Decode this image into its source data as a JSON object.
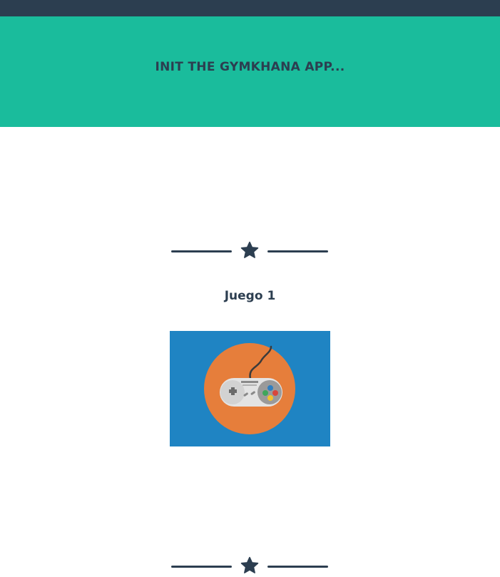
{
  "header": {
    "title": "INIT THE GYMKHANA APP..."
  },
  "games": [
    {
      "title": "Juego 1",
      "image": "gamepad-illustration"
    },
    {
      "title": "",
      "image": ""
    }
  ],
  "colors": {
    "topbar": "#2c3e50",
    "header": "#1abc9c",
    "text": "#2c3e50",
    "image_bg": "#1f84c3",
    "image_circle": "#e67e3b"
  },
  "icons": {
    "divider": "star-icon"
  }
}
